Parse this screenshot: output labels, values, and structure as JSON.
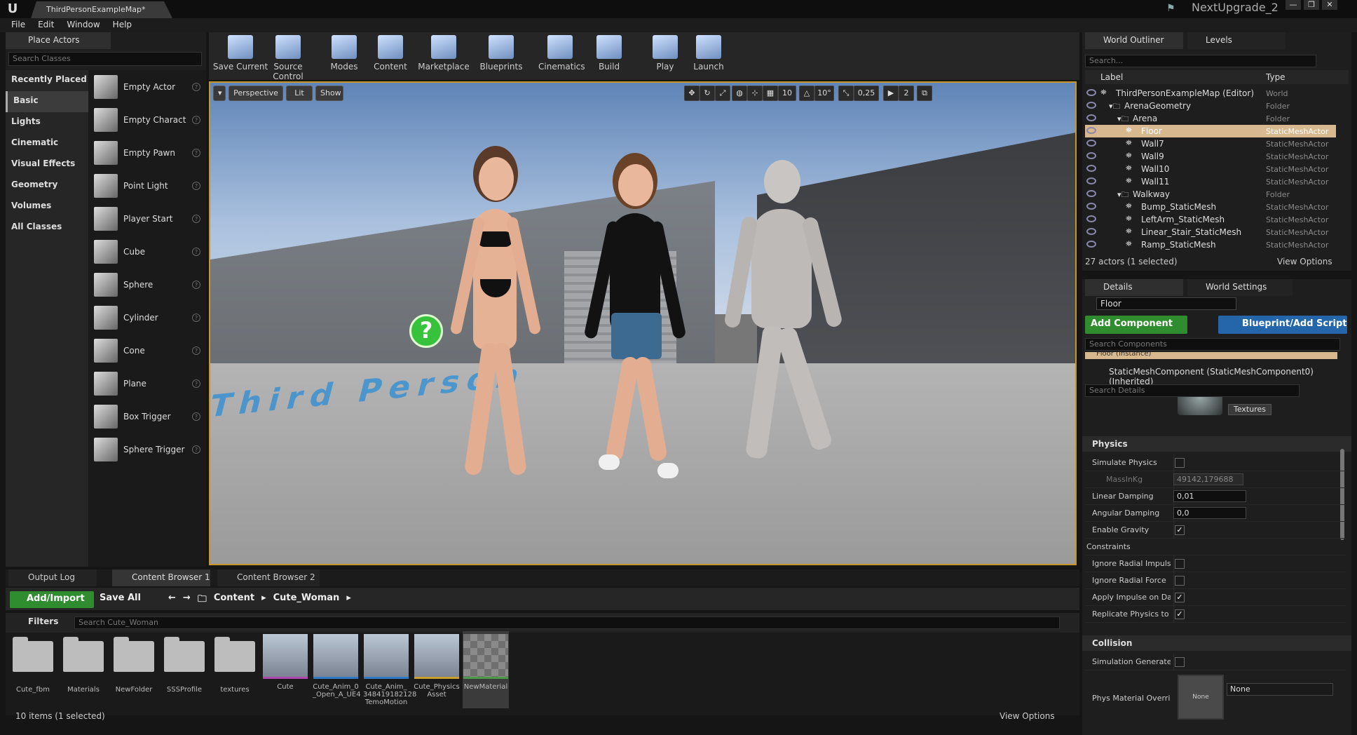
{
  "title_bar": {
    "tab_label": "ThirdPersonExampleMap*",
    "project_name": "NextUpgrade_2",
    "window_buttons": [
      "—",
      "❐",
      "✕"
    ]
  },
  "menu": [
    "File",
    "Edit",
    "Window",
    "Help"
  ],
  "place_actors": {
    "tab_label": "Place Actors",
    "search_placeholder": "Search Classes",
    "categories": [
      "Recently Placed",
      "Basic",
      "Lights",
      "Cinematic",
      "Visual Effects",
      "Geometry",
      "Volumes",
      "All Classes"
    ],
    "selected_category": "Basic",
    "actors": [
      "Empty Actor",
      "Empty Charact",
      "Empty Pawn",
      "Point Light",
      "Player Start",
      "Cube",
      "Sphere",
      "Cylinder",
      "Cone",
      "Plane",
      "Box Trigger",
      "Sphere Trigger"
    ]
  },
  "toolbar": [
    "Save Current",
    "Source Control",
    "Modes",
    "Content",
    "Marketplace",
    "Blueprints",
    "Cinematics",
    "Build",
    "Play",
    "Launch"
  ],
  "viewport": {
    "perspective_label": "Perspective",
    "lit_label": "Lit",
    "show_label": "Show",
    "grid_snap": "10",
    "rotation_snap": "10°",
    "scale_snap": "0,25",
    "camera_speed": "2",
    "floor_text": "Third Person"
  },
  "bottom_tabs": [
    "Output Log",
    "Content Browser 1",
    "Content Browser 2"
  ],
  "content_browser": {
    "add_import_label": "Add/Import",
    "save_all_label": "Save All",
    "breadcrumb": [
      "Content",
      "Cute_Woman"
    ],
    "filters_label": "Filters",
    "search_placeholder": "Search Cute_Woman",
    "assets": [
      {
        "name": "Cute_fbm",
        "kind": "folder"
      },
      {
        "name": "Materials",
        "kind": "folder"
      },
      {
        "name": "NewFolder",
        "kind": "folder"
      },
      {
        "name": "SSSProfile",
        "kind": "folder"
      },
      {
        "name": "textures",
        "kind": "folder"
      },
      {
        "name": "Cute",
        "kind": "mesh"
      },
      {
        "name": "Cute_Anim_0 _Open_A_UE4",
        "kind": "anim"
      },
      {
        "name": "Cute_Anim_ 348419182128 TemoMotion",
        "kind": "anim"
      },
      {
        "name": "Cute_Physics Asset",
        "kind": "physics"
      },
      {
        "name": "NewMaterial",
        "kind": "material"
      }
    ],
    "item_count": "10 items (1 selected)",
    "view_options": "View Options"
  },
  "outliner": {
    "tab_label": "World Outliner",
    "levels_tab": "Levels",
    "search_placeholder": "Search...",
    "col_label": "Label",
    "col_type": "Type",
    "rows": [
      {
        "label": "ThirdPersonExampleMap (Editor)",
        "type": "World"
      },
      {
        "label": "ArenaGeometry",
        "type": "Folder"
      },
      {
        "label": "Arena",
        "type": "Folder"
      },
      {
        "label": "Floor",
        "type": "StaticMeshActor"
      },
      {
        "label": "Wall7",
        "type": "StaticMeshActor"
      },
      {
        "label": "Wall9",
        "type": "StaticMeshActor"
      },
      {
        "label": "Wall10",
        "type": "StaticMeshActor"
      },
      {
        "label": "Wall11",
        "type": "StaticMeshActor"
      },
      {
        "label": "Walkway",
        "type": "Folder"
      },
      {
        "label": "Bump_StaticMesh",
        "type": "StaticMeshActor"
      },
      {
        "label": "LeftArm_StaticMesh",
        "type": "StaticMeshActor"
      },
      {
        "label": "Linear_Stair_StaticMesh",
        "type": "StaticMeshActor"
      },
      {
        "label": "Ramp_StaticMesh",
        "type": "StaticMeshActor"
      }
    ],
    "selected_row": "Floor",
    "actor_count": "27 actors (1 selected)",
    "view_options": "View Options"
  },
  "details": {
    "tab_label": "Details",
    "world_settings_tab": "World Settings",
    "object_name": "Floor",
    "add_component": "Add Component",
    "blueprint_script": "Blueprint/Add Script",
    "search_components": "Search Components",
    "instance_label": "Floor (Instance)",
    "component_label": "StaticMeshComponent (StaticMeshComponent0) (Inherited)",
    "search_details": "Search Details",
    "textures_btn": "Textures",
    "physics_section": "Physics",
    "physics": [
      {
        "label": "Simulate Physics",
        "kind": "check",
        "value": false
      },
      {
        "label": "MassInKg",
        "kind": "number",
        "value": "49142,179688"
      },
      {
        "label": "Linear Damping",
        "kind": "number",
        "value": "0,01"
      },
      {
        "label": "Angular Damping",
        "kind": "number",
        "value": "0,0"
      },
      {
        "label": "Enable Gravity",
        "kind": "check",
        "value": true
      },
      {
        "label": "Constraints",
        "kind": "group",
        "value": null
      },
      {
        "label": "Ignore Radial Impulse",
        "kind": "check",
        "value": false
      },
      {
        "label": "Ignore Radial Force",
        "kind": "check",
        "value": false
      },
      {
        "label": "Apply Impulse on Dam",
        "kind": "check",
        "value": true
      },
      {
        "label": "Replicate Physics to A",
        "kind": "check",
        "value": true
      }
    ],
    "collision_section": "Collision",
    "simulation_generates": "Simulation Generates",
    "phys_material_label": "Phys Material Overrid",
    "phys_material_value": "None",
    "none_thumb": "None"
  }
}
